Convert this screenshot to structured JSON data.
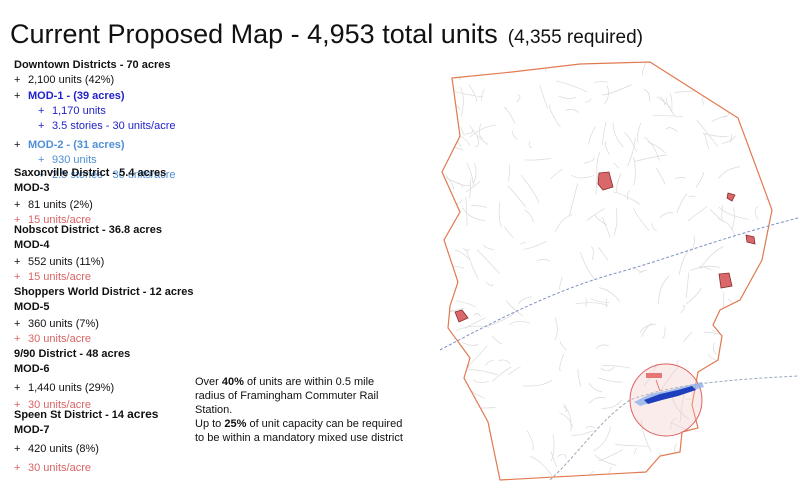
{
  "title": {
    "main": "Current Proposed Map - 4,953 total units",
    "sub": "(4,355 required)"
  },
  "downtown": {
    "heading": "Downtown Districts - 70 acres",
    "units": "2,100 units (42%)",
    "mod1": {
      "heading": "MOD-1 - (39 acres)",
      "units": "1,170 units",
      "density": "3.5 stories - 30 units/acre"
    },
    "mod2": {
      "heading": "MOD-2 - (31 acres)",
      "units": "930 units",
      "density": "2.5 stories - 30 units/acre"
    }
  },
  "saxonville": {
    "heading": "Saxonville District - 5.4 acres",
    "mod": "MOD-3",
    "units": "81 units (2%)",
    "density": "15 units/acre"
  },
  "nobscot": {
    "heading": "Nobscot District - 36.8 acres",
    "mod": "MOD-4",
    "units": "552 units (11%)",
    "density": "15 units/acre"
  },
  "shoppers": {
    "heading": "Shoppers World District - 12 acres",
    "mod": "MOD-5",
    "units": "360 units (7%)",
    "density": "30 units/acre"
  },
  "nine90": {
    "heading": "9/90 District - 48 acres",
    "mod": "MOD-6",
    "units": "1,440 units (29%)",
    "density": "30 units/acre"
  },
  "speen": {
    "heading_text": "Speen St District - 14",
    "heading_acres": "acres",
    "mod": "MOD-7",
    "units": "420 units (8%)",
    "density": "30 units/acre"
  },
  "note": {
    "p1_a": "Over ",
    "p1_b": "40%",
    "p1_c": " of units are within 0.5 mile radius of Framingham Commuter Rail Station.",
    "p2_a": "Up to ",
    "p2_b": "25%",
    "p2_c": " of unit capacity can be required to be within a mandatory mixed use district"
  },
  "plus": "+",
  "colors": {
    "red": "#d86464",
    "blue": "#2222cc",
    "light_blue": "#4f8fd6",
    "boundary": "#e07a50",
    "zone_fill": "#d9686a",
    "road": "#d9d9d9"
  }
}
